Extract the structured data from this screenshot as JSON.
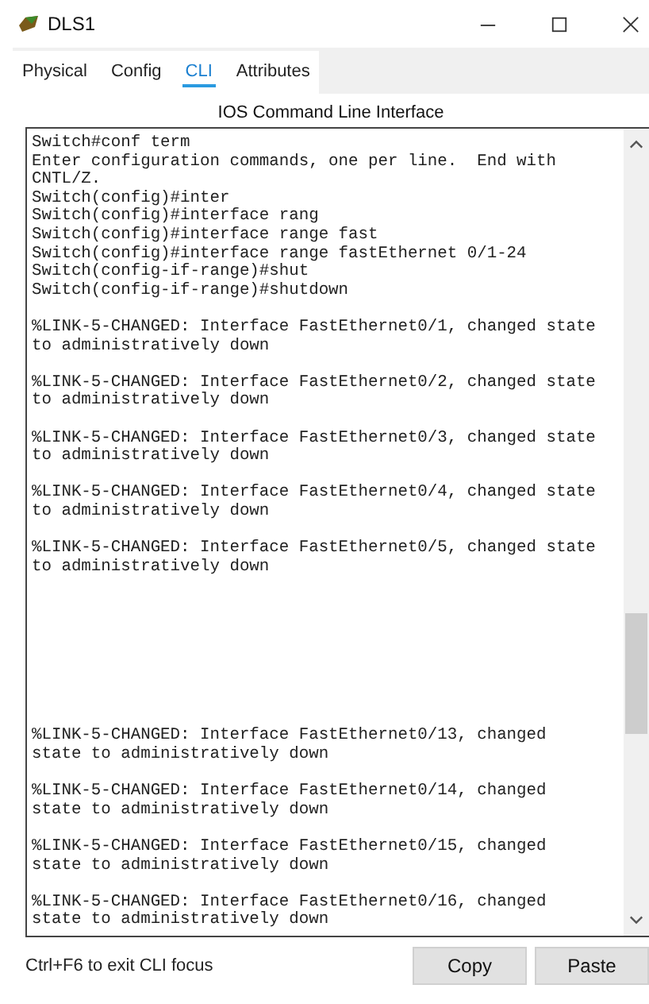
{
  "window": {
    "title": "DLS1"
  },
  "tabs": [
    {
      "label": "Physical",
      "selected": false
    },
    {
      "label": "Config",
      "selected": false
    },
    {
      "label": "CLI",
      "selected": true
    },
    {
      "label": "Attributes",
      "selected": false
    }
  ],
  "panel_title": "IOS Command Line Interface",
  "terminal": {
    "sections": [
      {
        "blocks": [
          [
            "Switch#conf term",
            "Enter configuration commands, one per line.  End with",
            "CNTL/Z.",
            "Switch(config)#inter",
            "Switch(config)#interface rang",
            "Switch(config)#interface range fast",
            "Switch(config)#interface range fastEthernet 0/1-24",
            "Switch(config-if-range)#shut",
            "Switch(config-if-range)#shutdown"
          ],
          [
            "%LINK-5-CHANGED: Interface FastEthernet0/1, changed state",
            "to administratively down"
          ],
          [
            "%LINK-5-CHANGED: Interface FastEthernet0/2, changed state",
            "to administratively down"
          ],
          [
            "%LINK-5-CHANGED: Interface FastEthernet0/3, changed state",
            "to administratively down"
          ],
          [
            "%LINK-5-CHANGED: Interface FastEthernet0/4, changed state",
            "to administratively down"
          ],
          [
            "%LINK-5-CHANGED: Interface FastEthernet0/5, changed state",
            "to administratively down"
          ]
        ]
      },
      {
        "blocks": [
          [
            "%LINK-5-CHANGED: Interface FastEthernet0/13, changed",
            "state to administratively down"
          ],
          [
            "%LINK-5-CHANGED: Interface FastEthernet0/14, changed",
            "state to administratively down"
          ],
          [
            "%LINK-5-CHANGED: Interface FastEthernet0/15, changed",
            "state to administratively down"
          ],
          [
            "%LINK-5-CHANGED: Interface FastEthernet0/16, changed",
            "state to administratively down"
          ]
        ]
      }
    ]
  },
  "hint": "Ctrl+F6 to exit CLI focus",
  "buttons": [
    "Copy",
    "Paste"
  ]
}
